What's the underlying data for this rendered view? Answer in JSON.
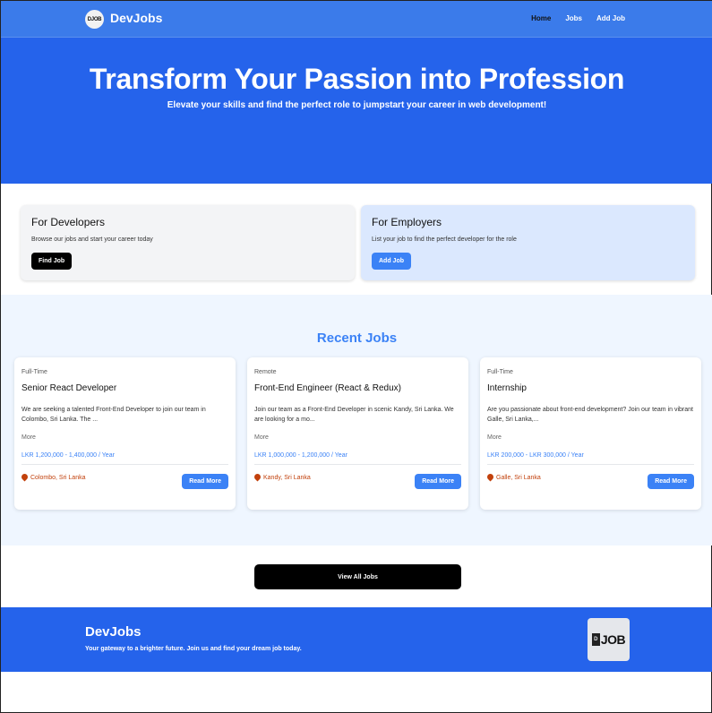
{
  "nav": {
    "logo_text": "DJOB",
    "brand": "DevJobs",
    "links": [
      "Home",
      "Jobs",
      "Add Job"
    ]
  },
  "hero": {
    "title": "Transform Your Passion into Profession",
    "subtitle": "Elevate your skills and find the perfect role to jumpstart your career in web development!"
  },
  "developers": {
    "title": "For Developers",
    "description": "Browse our jobs and start your career today",
    "button": "Find Job"
  },
  "employers": {
    "title": "For Employers",
    "description": "List your job to find the perfect developer for the role",
    "button": "Add Job"
  },
  "recent": {
    "heading": "Recent Jobs",
    "jobs": [
      {
        "type": "Full-Time",
        "title": "Senior React Developer",
        "description": "We are seeking a talented Front-End Developer to join our team in Colombo, Sri Lanka. The ...",
        "more": "More",
        "salary": "LKR 1,200,000 - 1,400,000 / Year",
        "location": "Colombo, Sri Lanka",
        "button": "Read More"
      },
      {
        "type": "Remote",
        "title": "Front-End Engineer (React & Redux)",
        "description": "Join our team as a Front-End Developer in scenic Kandy, Sri Lanka. We are looking for a mo...",
        "more": "More",
        "salary": "LKR 1,000,000 - 1,200,000 / Year",
        "location": "Kandy, Sri Lanka",
        "button": "Read More"
      },
      {
        "type": "Full-Time",
        "title": "Internship",
        "description": "Are you passionate about front-end development? Join our team in vibrant Galle, Sri Lanka,...",
        "more": "More",
        "salary": "LKR 200,000 - LKR 300,000 / Year",
        "location": "Galle, Sri Lanka",
        "button": "Read More"
      }
    ]
  },
  "view_all": "View All Jobs",
  "footer": {
    "brand": "DevJobs",
    "tagline": "Your gateway to a brighter future. Join us and find your dream job today.",
    "logo_box_text": "D",
    "logo_text": "JOB"
  },
  "colors": {
    "primary": "#2563eb",
    "accent": "#3b82f6",
    "location": "#c2410c"
  }
}
